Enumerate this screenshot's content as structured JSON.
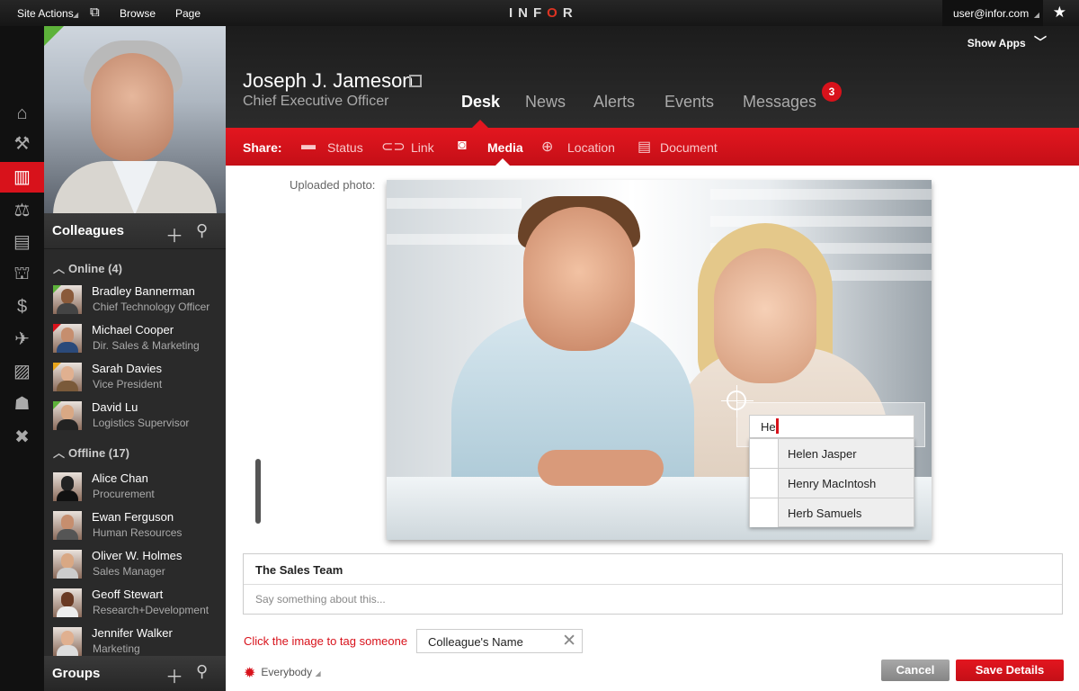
{
  "topbar": {
    "site_actions": "Site Actions",
    "browse": "Browse",
    "page": "Page",
    "logo_pre": "INF",
    "logo_mid": "O",
    "logo_post": "R",
    "user": "user@infor.com"
  },
  "header": {
    "name": "Joseph J. Jameson",
    "title": "Chief Executive Officer",
    "show_apps": "Show Apps",
    "tabs": [
      {
        "label": "Desk"
      },
      {
        "label": "News"
      },
      {
        "label": "Alerts"
      },
      {
        "label": "Events"
      },
      {
        "label": "Messages"
      }
    ],
    "messages_badge": "3"
  },
  "share": {
    "label": "Share:",
    "items": [
      {
        "label": "Status"
      },
      {
        "label": "Link"
      },
      {
        "label": "Media"
      },
      {
        "label": "Location"
      },
      {
        "label": "Document"
      }
    ]
  },
  "colleagues": {
    "title": "Colleagues",
    "online_label": "Online (4)",
    "offline_label": "Offline (17)",
    "online": [
      {
        "name": "Bradley Bannerman",
        "role": "Chief Technology Officer"
      },
      {
        "name": "Michael Cooper",
        "role": "Dir. Sales & Marketing"
      },
      {
        "name": "Sarah Davies",
        "role": "Vice President"
      },
      {
        "name": "David Lu",
        "role": "Logistics Supervisor"
      }
    ],
    "offline": [
      {
        "name": "Alice Chan",
        "role": "Procurement"
      },
      {
        "name": "Ewan Ferguson",
        "role": "Human Resources"
      },
      {
        "name": "Oliver W. Holmes",
        "role": "Sales Manager"
      },
      {
        "name": "Geoff Stewart",
        "role": "Research+Development"
      },
      {
        "name": "Jennifer Walker",
        "role": "Marketing"
      }
    ]
  },
  "groups": {
    "title": "Groups"
  },
  "media": {
    "uploaded_label": "Uploaded photo:",
    "tag_input": "He",
    "suggestions": [
      {
        "name": "Helen Jasper"
      },
      {
        "name": "Henry MacIntosh"
      },
      {
        "name": "Herb Samuels"
      }
    ]
  },
  "post": {
    "team": "The Sales Team",
    "placeholder": "Say something about this...",
    "hint": "Click the image to tag someone",
    "colleague_field": "Colleague's Name",
    "audience": "Everybody"
  },
  "buttons": {
    "cancel": "Cancel",
    "save": "Save Details"
  }
}
